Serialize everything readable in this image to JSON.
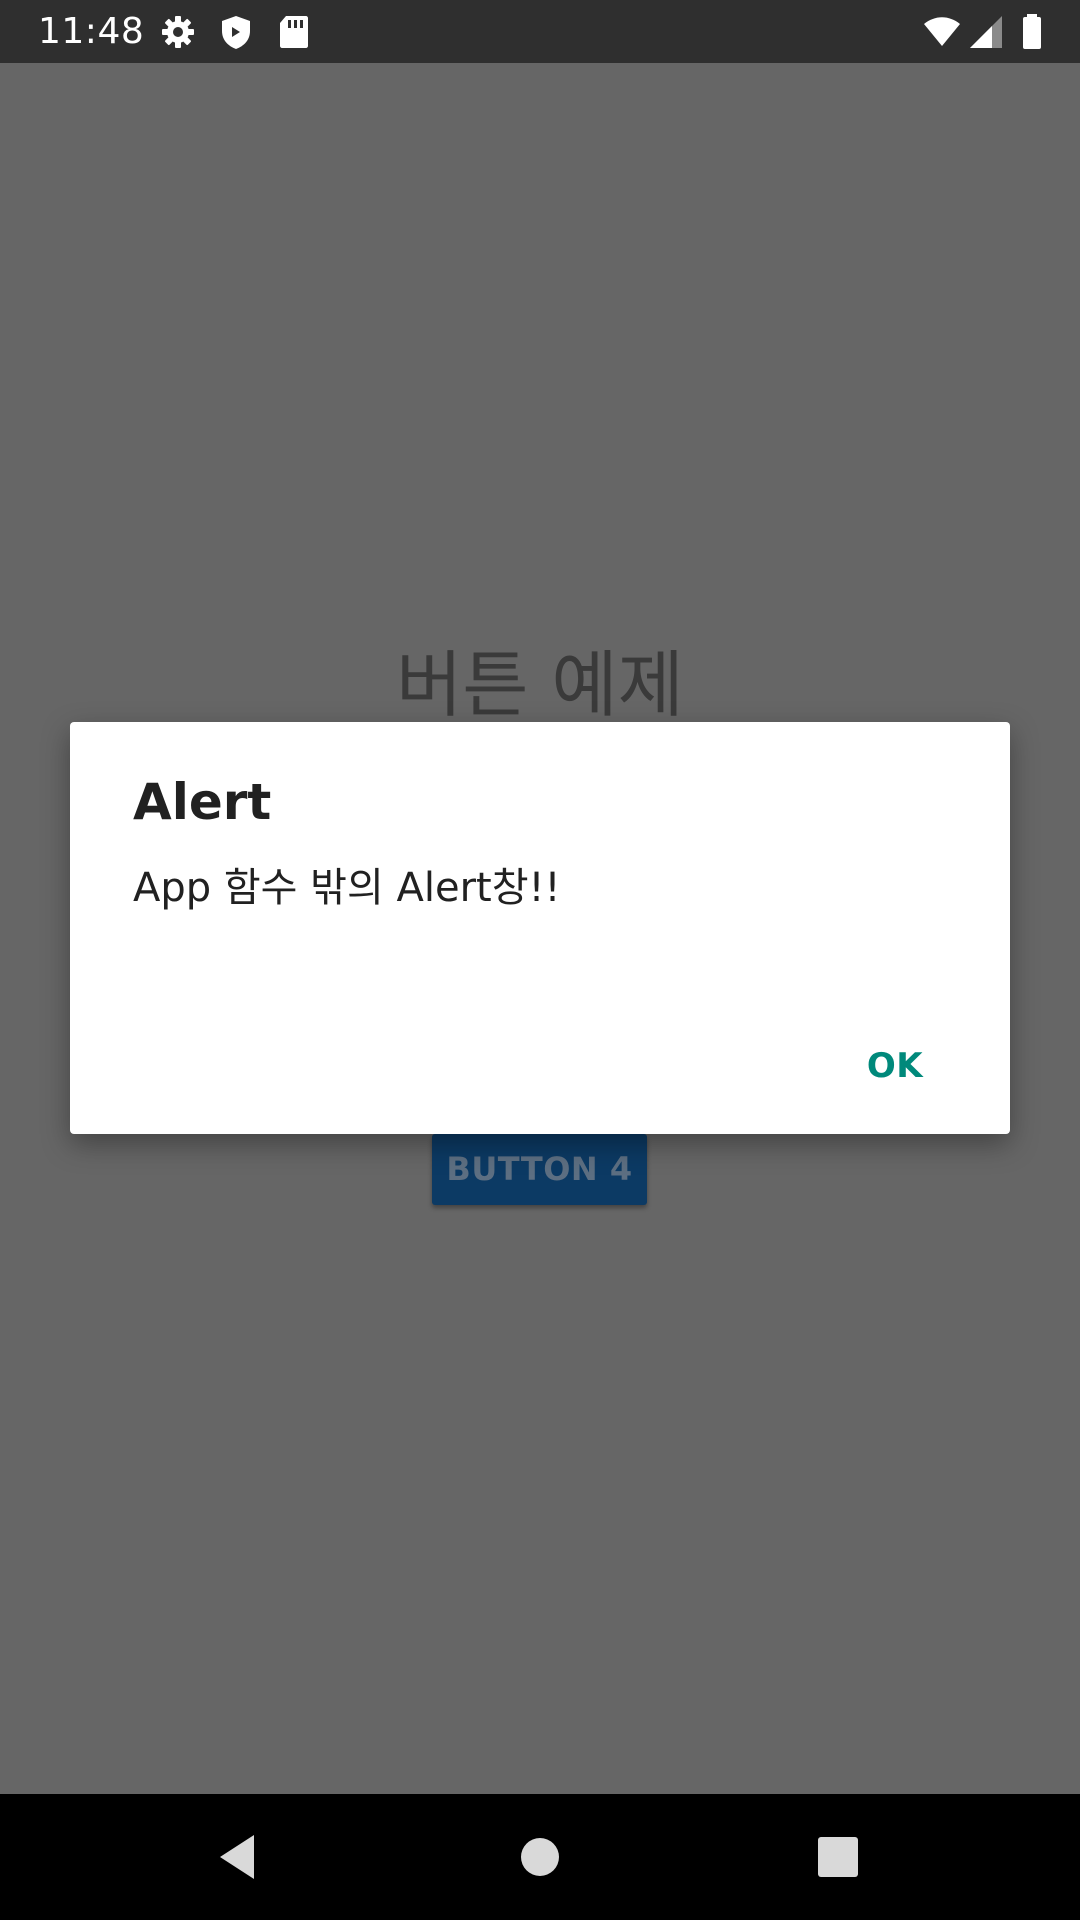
{
  "status_bar": {
    "time": "11:48",
    "icons": [
      "gear-icon",
      "shield-icon",
      "sd-card-icon",
      "wifi-icon",
      "signal-icon",
      "battery-icon"
    ]
  },
  "app": {
    "title": "버튼 예제",
    "button4_label": "BUTTON 4",
    "button4_color": "#0c3a64"
  },
  "dialog": {
    "title": "Alert",
    "message": "App 함수 밖의 Alert창!!",
    "ok_label": "OK",
    "accent_color": "#00897b"
  },
  "nav_bar": {
    "buttons": [
      "back-icon",
      "home-icon",
      "recents-icon"
    ]
  }
}
